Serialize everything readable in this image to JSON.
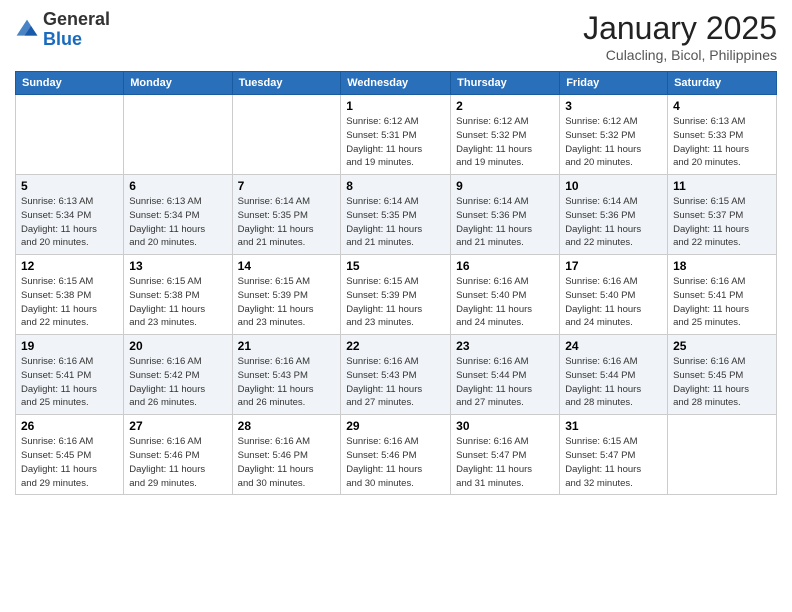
{
  "header": {
    "logo_general": "General",
    "logo_blue": "Blue",
    "month_title": "January 2025",
    "location": "Culacling, Bicol, Philippines"
  },
  "weekdays": [
    "Sunday",
    "Monday",
    "Tuesday",
    "Wednesday",
    "Thursday",
    "Friday",
    "Saturday"
  ],
  "weeks": [
    [
      {
        "day": "",
        "info": ""
      },
      {
        "day": "",
        "info": ""
      },
      {
        "day": "",
        "info": ""
      },
      {
        "day": "1",
        "info": "Sunrise: 6:12 AM\nSunset: 5:31 PM\nDaylight: 11 hours\nand 19 minutes."
      },
      {
        "day": "2",
        "info": "Sunrise: 6:12 AM\nSunset: 5:32 PM\nDaylight: 11 hours\nand 19 minutes."
      },
      {
        "day": "3",
        "info": "Sunrise: 6:12 AM\nSunset: 5:32 PM\nDaylight: 11 hours\nand 20 minutes."
      },
      {
        "day": "4",
        "info": "Sunrise: 6:13 AM\nSunset: 5:33 PM\nDaylight: 11 hours\nand 20 minutes."
      }
    ],
    [
      {
        "day": "5",
        "info": "Sunrise: 6:13 AM\nSunset: 5:34 PM\nDaylight: 11 hours\nand 20 minutes."
      },
      {
        "day": "6",
        "info": "Sunrise: 6:13 AM\nSunset: 5:34 PM\nDaylight: 11 hours\nand 20 minutes."
      },
      {
        "day": "7",
        "info": "Sunrise: 6:14 AM\nSunset: 5:35 PM\nDaylight: 11 hours\nand 21 minutes."
      },
      {
        "day": "8",
        "info": "Sunrise: 6:14 AM\nSunset: 5:35 PM\nDaylight: 11 hours\nand 21 minutes."
      },
      {
        "day": "9",
        "info": "Sunrise: 6:14 AM\nSunset: 5:36 PM\nDaylight: 11 hours\nand 21 minutes."
      },
      {
        "day": "10",
        "info": "Sunrise: 6:14 AM\nSunset: 5:36 PM\nDaylight: 11 hours\nand 22 minutes."
      },
      {
        "day": "11",
        "info": "Sunrise: 6:15 AM\nSunset: 5:37 PM\nDaylight: 11 hours\nand 22 minutes."
      }
    ],
    [
      {
        "day": "12",
        "info": "Sunrise: 6:15 AM\nSunset: 5:38 PM\nDaylight: 11 hours\nand 22 minutes."
      },
      {
        "day": "13",
        "info": "Sunrise: 6:15 AM\nSunset: 5:38 PM\nDaylight: 11 hours\nand 23 minutes."
      },
      {
        "day": "14",
        "info": "Sunrise: 6:15 AM\nSunset: 5:39 PM\nDaylight: 11 hours\nand 23 minutes."
      },
      {
        "day": "15",
        "info": "Sunrise: 6:15 AM\nSunset: 5:39 PM\nDaylight: 11 hours\nand 23 minutes."
      },
      {
        "day": "16",
        "info": "Sunrise: 6:16 AM\nSunset: 5:40 PM\nDaylight: 11 hours\nand 24 minutes."
      },
      {
        "day": "17",
        "info": "Sunrise: 6:16 AM\nSunset: 5:40 PM\nDaylight: 11 hours\nand 24 minutes."
      },
      {
        "day": "18",
        "info": "Sunrise: 6:16 AM\nSunset: 5:41 PM\nDaylight: 11 hours\nand 25 minutes."
      }
    ],
    [
      {
        "day": "19",
        "info": "Sunrise: 6:16 AM\nSunset: 5:41 PM\nDaylight: 11 hours\nand 25 minutes."
      },
      {
        "day": "20",
        "info": "Sunrise: 6:16 AM\nSunset: 5:42 PM\nDaylight: 11 hours\nand 26 minutes."
      },
      {
        "day": "21",
        "info": "Sunrise: 6:16 AM\nSunset: 5:43 PM\nDaylight: 11 hours\nand 26 minutes."
      },
      {
        "day": "22",
        "info": "Sunrise: 6:16 AM\nSunset: 5:43 PM\nDaylight: 11 hours\nand 27 minutes."
      },
      {
        "day": "23",
        "info": "Sunrise: 6:16 AM\nSunset: 5:44 PM\nDaylight: 11 hours\nand 27 minutes."
      },
      {
        "day": "24",
        "info": "Sunrise: 6:16 AM\nSunset: 5:44 PM\nDaylight: 11 hours\nand 28 minutes."
      },
      {
        "day": "25",
        "info": "Sunrise: 6:16 AM\nSunset: 5:45 PM\nDaylight: 11 hours\nand 28 minutes."
      }
    ],
    [
      {
        "day": "26",
        "info": "Sunrise: 6:16 AM\nSunset: 5:45 PM\nDaylight: 11 hours\nand 29 minutes."
      },
      {
        "day": "27",
        "info": "Sunrise: 6:16 AM\nSunset: 5:46 PM\nDaylight: 11 hours\nand 29 minutes."
      },
      {
        "day": "28",
        "info": "Sunrise: 6:16 AM\nSunset: 5:46 PM\nDaylight: 11 hours\nand 30 minutes."
      },
      {
        "day": "29",
        "info": "Sunrise: 6:16 AM\nSunset: 5:46 PM\nDaylight: 11 hours\nand 30 minutes."
      },
      {
        "day": "30",
        "info": "Sunrise: 6:16 AM\nSunset: 5:47 PM\nDaylight: 11 hours\nand 31 minutes."
      },
      {
        "day": "31",
        "info": "Sunrise: 6:15 AM\nSunset: 5:47 PM\nDaylight: 11 hours\nand 32 minutes."
      },
      {
        "day": "",
        "info": ""
      }
    ]
  ]
}
